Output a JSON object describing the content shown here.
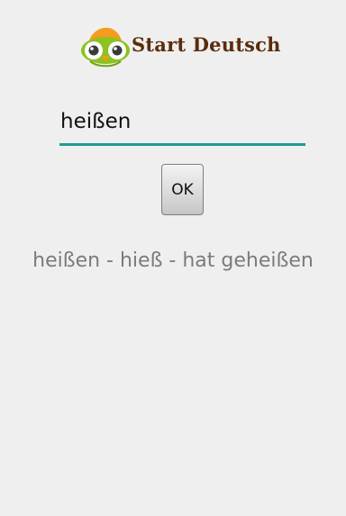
{
  "header": {
    "app_title": "Start Deutsch",
    "logo_icon": "owl-logo-icon",
    "colors": {
      "title": "#5a2d0c",
      "owl_body": "#8dc21f",
      "owl_tuft": "#f39c1e"
    }
  },
  "form": {
    "input_value": "heißen",
    "input_placeholder": "",
    "ok_label": "OK",
    "accent_color": "#1f9c91"
  },
  "result": {
    "text": "heißen - hieß - hat geheißen"
  }
}
